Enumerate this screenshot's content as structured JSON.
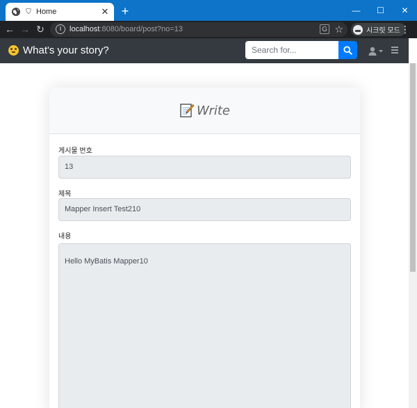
{
  "browser": {
    "tab_title": "Home",
    "tab_close": "✕",
    "new_tab": "+",
    "url_host": "localhost",
    "url_rest": ":8080/board/post?no=13",
    "incognito_label": "시크릿 모드",
    "window_controls": [
      "—",
      "☐",
      "✕"
    ]
  },
  "navbar": {
    "brand": "What's your story?",
    "search_placeholder": "Search for...",
    "brand_icon": "smiley-icon",
    "search_icon": "search-icon",
    "user_icon": "user-icon",
    "menu_icon": "hamburger-icon"
  },
  "card": {
    "title": "Write",
    "title_icon": "memo-icon"
  },
  "form": {
    "fields": [
      {
        "label": "게시물 번호",
        "value": "13"
      },
      {
        "label": "제목",
        "value": "Mapper Insert Test210"
      },
      {
        "label": "내용",
        "value": "Hello MyBatis Mapper10"
      }
    ]
  },
  "colors": {
    "titlebar": "#0d74c9",
    "navbar": "#343a40",
    "search_button": "#007bff",
    "field_background": "#e9ecef"
  }
}
